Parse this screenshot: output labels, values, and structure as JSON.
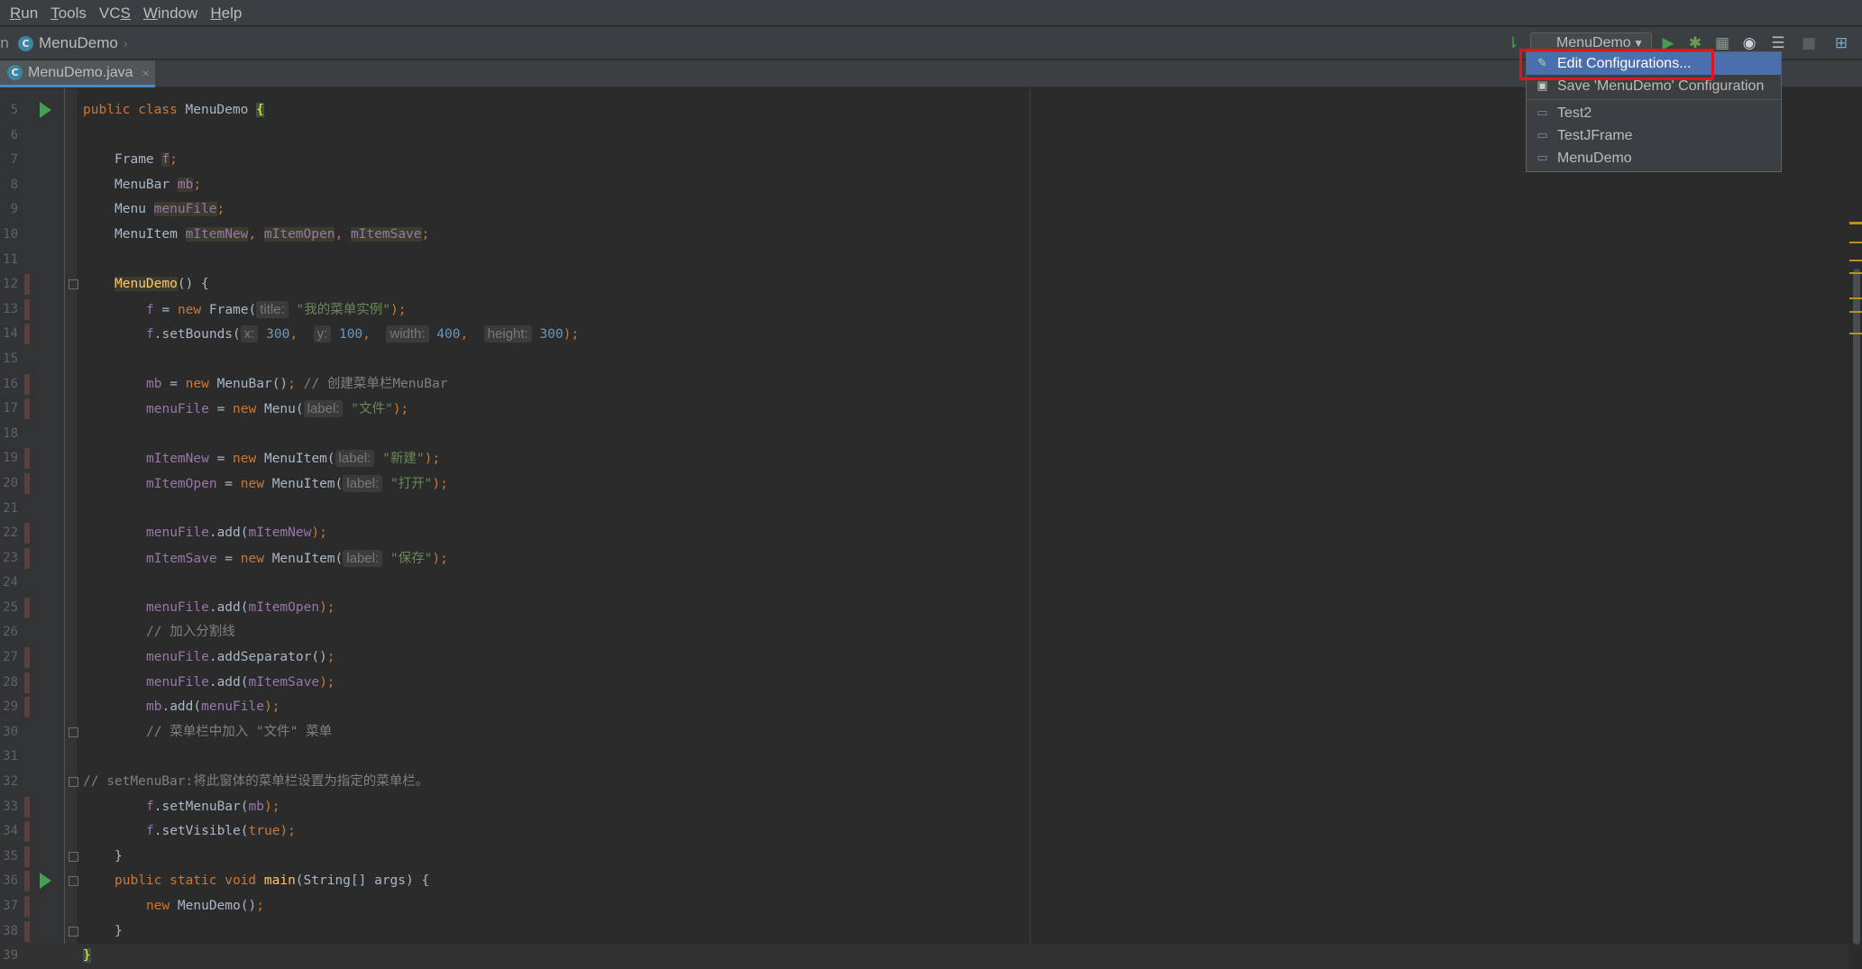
{
  "menubar": {
    "items": [
      "Run",
      "Tools",
      "VCS",
      "Window",
      "Help"
    ],
    "mnemonic_index": [
      0,
      0,
      2,
      0,
      0
    ]
  },
  "nav": {
    "breadcrumb": "MenuDemo",
    "run_config": "MenuDemo"
  },
  "tab": {
    "name": "MenuDemo.java"
  },
  "popup": {
    "items": [
      {
        "label": "Edit Configurations...",
        "icon": "edit-config-icon",
        "selected": true
      },
      {
        "label": "Save 'MenuDemo' Configuration",
        "icon": "save-config-icon"
      },
      {
        "label": "Test2",
        "icon": "app-config-icon"
      },
      {
        "label": "TestJFrame",
        "icon": "app-config-icon"
      },
      {
        "label": "MenuDemo",
        "icon": "app-config-icon"
      }
    ]
  },
  "colors": {
    "keyword": "#cc7832",
    "field": "#9876aa",
    "string": "#6a8759",
    "number": "#6897bb",
    "comment": "#808080",
    "selection": "#4b6eaf",
    "highlight_box": "#e0141e"
  },
  "code": {
    "lines": [
      {
        "n": "5",
        "indent": 0,
        "vcs": false,
        "run": true,
        "fold": false,
        "segs": [
          [
            "public class ",
            "kw"
          ],
          [
            "MenuDemo ",
            ""
          ],
          [
            "{",
            "brace"
          ]
        ]
      },
      {
        "n": "6",
        "indent": 0,
        "vcs": false,
        "run": false,
        "fold": false,
        "segs": []
      },
      {
        "n": "7",
        "indent": 1,
        "vcs": false,
        "run": false,
        "fold": false,
        "segs": [
          [
            "Frame ",
            ""
          ],
          [
            "f",
            "hl"
          ],
          [
            ";",
            "kw"
          ]
        ]
      },
      {
        "n": "8",
        "indent": 1,
        "vcs": false,
        "run": false,
        "fold": false,
        "segs": [
          [
            "MenuBar ",
            ""
          ],
          [
            "mb",
            "hl"
          ],
          [
            ";",
            "kw"
          ]
        ]
      },
      {
        "n": "9",
        "indent": 1,
        "vcs": false,
        "run": false,
        "fold": false,
        "segs": [
          [
            "Menu ",
            ""
          ],
          [
            "menuFile",
            "hl"
          ],
          [
            ";",
            "kw"
          ]
        ]
      },
      {
        "n": "10",
        "indent": 1,
        "vcs": false,
        "run": false,
        "fold": false,
        "segs": [
          [
            "MenuItem ",
            ""
          ],
          [
            "mItemNew",
            "hl"
          ],
          [
            ", ",
            "kw"
          ],
          [
            "mItemOpen",
            "hl"
          ],
          [
            ", ",
            "kw"
          ],
          [
            "mItemSave",
            "hl"
          ],
          [
            ";",
            "kw"
          ]
        ]
      },
      {
        "n": "11",
        "indent": 0,
        "vcs": false,
        "run": false,
        "fold": false,
        "segs": []
      },
      {
        "n": "12",
        "indent": 1,
        "vcs": true,
        "run": false,
        "fold": true,
        "segs": [
          [
            "MenuDemo",
            "ctor"
          ],
          [
            "() {",
            ""
          ]
        ]
      },
      {
        "n": "13",
        "indent": 2,
        "vcs": true,
        "run": false,
        "fold": false,
        "segs": [
          [
            "f",
            "fld"
          ],
          [
            " = ",
            ""
          ],
          [
            "new ",
            "kw"
          ],
          [
            "Frame(",
            ""
          ],
          [
            "title:",
            "hint"
          ],
          [
            " \"我的菜单实例\"",
            "str"
          ],
          [
            ");",
            "kw"
          ]
        ]
      },
      {
        "n": "14",
        "indent": 2,
        "vcs": true,
        "run": false,
        "fold": false,
        "segs": [
          [
            "f",
            "fld"
          ],
          [
            ".setBounds(",
            ""
          ],
          [
            "x:",
            "hint"
          ],
          [
            " 300",
            "num"
          ],
          [
            ",  ",
            "kw"
          ],
          [
            "y:",
            "hint"
          ],
          [
            " 100",
            "num"
          ],
          [
            ",  ",
            "kw"
          ],
          [
            "width:",
            "hint"
          ],
          [
            " 400",
            "num"
          ],
          [
            ",  ",
            "kw"
          ],
          [
            "height:",
            "hint"
          ],
          [
            " 300",
            "num"
          ],
          [
            ");",
            "kw"
          ]
        ]
      },
      {
        "n": "15",
        "indent": 0,
        "vcs": false,
        "run": false,
        "fold": false,
        "segs": []
      },
      {
        "n": "16",
        "indent": 2,
        "vcs": true,
        "run": false,
        "fold": false,
        "segs": [
          [
            "mb",
            "fld"
          ],
          [
            " = ",
            ""
          ],
          [
            "new ",
            "kw"
          ],
          [
            "MenuBar()",
            ""
          ],
          [
            "; ",
            "kw"
          ],
          [
            "// 创建菜单栏MenuBar",
            "cmt"
          ]
        ]
      },
      {
        "n": "17",
        "indent": 2,
        "vcs": true,
        "run": false,
        "fold": false,
        "segs": [
          [
            "menuFile",
            "fld"
          ],
          [
            " = ",
            ""
          ],
          [
            "new ",
            "kw"
          ],
          [
            "Menu(",
            ""
          ],
          [
            "label:",
            "hint"
          ],
          [
            " \"文件\"",
            "str"
          ],
          [
            ");",
            "kw"
          ]
        ]
      },
      {
        "n": "18",
        "indent": 0,
        "vcs": false,
        "run": false,
        "fold": false,
        "segs": []
      },
      {
        "n": "19",
        "indent": 2,
        "vcs": true,
        "run": false,
        "fold": false,
        "segs": [
          [
            "mItemNew",
            "fld"
          ],
          [
            " = ",
            ""
          ],
          [
            "new ",
            "kw"
          ],
          [
            "MenuItem(",
            ""
          ],
          [
            "label:",
            "hint"
          ],
          [
            " \"新建\"",
            "str"
          ],
          [
            ");",
            "kw"
          ]
        ]
      },
      {
        "n": "20",
        "indent": 2,
        "vcs": true,
        "run": false,
        "fold": false,
        "segs": [
          [
            "mItemOpen",
            "fld"
          ],
          [
            " = ",
            ""
          ],
          [
            "new ",
            "kw"
          ],
          [
            "MenuItem(",
            ""
          ],
          [
            "label:",
            "hint"
          ],
          [
            " \"打开\"",
            "str"
          ],
          [
            ");",
            "kw"
          ]
        ]
      },
      {
        "n": "21",
        "indent": 0,
        "vcs": false,
        "run": false,
        "fold": false,
        "segs": []
      },
      {
        "n": "22",
        "indent": 2,
        "vcs": true,
        "run": false,
        "fold": false,
        "segs": [
          [
            "menuFile",
            "fld"
          ],
          [
            ".add(",
            ""
          ],
          [
            "mItemNew",
            "fld"
          ],
          [
            ");",
            "kw"
          ]
        ]
      },
      {
        "n": "23",
        "indent": 2,
        "vcs": true,
        "run": false,
        "fold": false,
        "segs": [
          [
            "mItemSave",
            "fld"
          ],
          [
            " = ",
            ""
          ],
          [
            "new ",
            "kw"
          ],
          [
            "MenuItem(",
            ""
          ],
          [
            "label:",
            "hint"
          ],
          [
            " \"保存\"",
            "str"
          ],
          [
            ");",
            "kw"
          ]
        ]
      },
      {
        "n": "24",
        "indent": 0,
        "vcs": false,
        "run": false,
        "fold": false,
        "segs": []
      },
      {
        "n": "25",
        "indent": 2,
        "vcs": true,
        "run": false,
        "fold": false,
        "segs": [
          [
            "menuFile",
            "fld"
          ],
          [
            ".add(",
            ""
          ],
          [
            "mItemOpen",
            "fld"
          ],
          [
            ");",
            "kw"
          ]
        ]
      },
      {
        "n": "26",
        "indent": 2,
        "vcs": false,
        "run": false,
        "fold": false,
        "segs": [
          [
            "// 加入分割线",
            "cmt"
          ]
        ]
      },
      {
        "n": "27",
        "indent": 2,
        "vcs": true,
        "run": false,
        "fold": false,
        "segs": [
          [
            "menuFile",
            "fld"
          ],
          [
            ".addSeparator()",
            ""
          ],
          [
            ";",
            "kw"
          ]
        ]
      },
      {
        "n": "28",
        "indent": 2,
        "vcs": true,
        "run": false,
        "fold": false,
        "segs": [
          [
            "menuFile",
            "fld"
          ],
          [
            ".add(",
            ""
          ],
          [
            "mItemSave",
            "fld"
          ],
          [
            ");",
            "kw"
          ]
        ]
      },
      {
        "n": "29",
        "indent": 2,
        "vcs": true,
        "run": false,
        "fold": false,
        "segs": [
          [
            "mb",
            "fld"
          ],
          [
            ".add(",
            ""
          ],
          [
            "menuFile",
            "fld"
          ],
          [
            ");",
            "kw"
          ]
        ]
      },
      {
        "n": "30",
        "indent": 2,
        "vcs": false,
        "run": false,
        "fold": true,
        "segs": [
          [
            "// 菜单栏中加入 \"文件\" 菜单",
            "cmt"
          ]
        ]
      },
      {
        "n": "31",
        "indent": 0,
        "vcs": false,
        "run": false,
        "fold": false,
        "segs": []
      },
      {
        "n": "32",
        "indent": 0,
        "vcs": false,
        "run": false,
        "fold": true,
        "segs": [
          [
            "// setMenuBar:将此窗体的菜单栏设置为指定的菜单栏。",
            "cmt"
          ]
        ]
      },
      {
        "n": "33",
        "indent": 2,
        "vcs": true,
        "run": false,
        "fold": false,
        "segs": [
          [
            "f",
            "fld"
          ],
          [
            ".setMenuBar(",
            ""
          ],
          [
            "mb",
            "fld"
          ],
          [
            ");",
            "kw"
          ]
        ]
      },
      {
        "n": "34",
        "indent": 2,
        "vcs": true,
        "run": false,
        "fold": false,
        "segs": [
          [
            "f",
            "fld"
          ],
          [
            ".setVisible(",
            ""
          ],
          [
            "true",
            "kw"
          ],
          [
            ");",
            "kw"
          ]
        ]
      },
      {
        "n": "35",
        "indent": 1,
        "vcs": true,
        "run": false,
        "fold": true,
        "segs": [
          [
            "}",
            ""
          ]
        ]
      },
      {
        "n": "36",
        "indent": 1,
        "vcs": true,
        "run": true,
        "fold": true,
        "segs": [
          [
            "public static void ",
            "kw"
          ],
          [
            "main",
            "mth"
          ],
          [
            "(String[] args) {",
            ""
          ]
        ]
      },
      {
        "n": "37",
        "indent": 2,
        "vcs": true,
        "run": false,
        "fold": false,
        "segs": [
          [
            "new ",
            "kw"
          ],
          [
            "MenuDemo()",
            ""
          ],
          [
            ";",
            "kw"
          ]
        ]
      },
      {
        "n": "38",
        "indent": 1,
        "vcs": true,
        "run": false,
        "fold": true,
        "segs": [
          [
            "}",
            ""
          ]
        ]
      },
      {
        "n": "39",
        "indent": 0,
        "vcs": false,
        "run": false,
        "fold": false,
        "current": true,
        "segs": [
          [
            "}",
            "brace"
          ]
        ]
      }
    ]
  }
}
